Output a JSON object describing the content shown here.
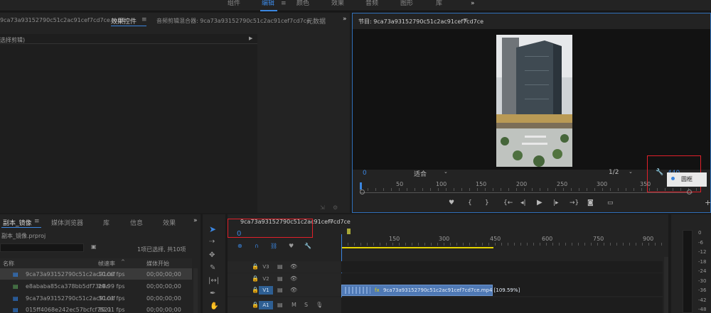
{
  "workspaces": [
    "组件",
    "编辑",
    "颜色",
    "效果",
    "音频",
    "图形",
    "库"
  ],
  "workspace_active_index": 1,
  "workspace_more": "»",
  "source_panel": {
    "tab_clip": "9ca73a93152790c51c2ac91cef7cd7ce.mp4",
    "tab_effects": "效果控件",
    "tab_mixer": "音频剪辑混合器: 9ca73a93152790c51c2ac91cef7cd7ce",
    "tab_meta": "元数据",
    "more": "»",
    "selection_hint": "选择剪辑)"
  },
  "program_monitor": {
    "title": "节目: 9ca73a93152790c51c2ac91cef7cd7ce",
    "timecode_left": "0",
    "fit_label": "适合",
    "quality": "1/2",
    "timecode_right": "440",
    "popup_item": "圆框",
    "ruler_labels": [
      "50",
      "100",
      "150",
      "200",
      "250",
      "300",
      "350"
    ],
    "controls": [
      "♥",
      "{",
      "}",
      "{←",
      "◂|",
      "▶",
      "|▸",
      "→}",
      "◙",
      "▭",
      "+"
    ]
  },
  "project_panel": {
    "tab_project": "副本_镜像",
    "tab_media": "媒体浏览器",
    "tab_library": "库",
    "tab_info": "信息",
    "tab_effects": "效果",
    "more": "»",
    "file_name": "副本_镜像.prproj",
    "selection_status": "1项已选择, 共10项",
    "col_name": "名称",
    "col_fps": "帧速率",
    "col_start": "媒体开始",
    "rows": [
      {
        "name": "9ca73a93152790c51c2ac91cef",
        "fps": "10.00 fps",
        "start": "00;00;00;00"
      },
      {
        "name": "e8ababa85ca378bb5df73b8c",
        "fps": "29.99 fps",
        "start": "00;00;00;00"
      },
      {
        "name": "9ca73a93152790c51c2ac91cef",
        "fps": "30.01 fps",
        "start": "00;00;00;00"
      },
      {
        "name": "015ff4068e242ec57bcfcf7521",
        "fps": "30.01 fps",
        "start": "00;00;00;00"
      }
    ]
  },
  "timeline": {
    "title": "9ca73a93152790c51c2ac91cef7cd7ce",
    "timecode": "0",
    "ruler_labels": [
      "150",
      "300",
      "450",
      "600",
      "750",
      "900"
    ],
    "tracks": [
      "V3",
      "V2",
      "V1",
      "A1"
    ],
    "clip_label": "9ca73a93152790c51c2ac91cef7cd7ce.mp4 [109.59%]",
    "clip_fx": "fx"
  },
  "meters": {
    "labels": [
      "0",
      "-6",
      "-12",
      "-18",
      "-24",
      "-30",
      "-36",
      "-42",
      "-48"
    ]
  },
  "colors": {
    "accent": "#3b86e0",
    "highlight_box": "#e0202a",
    "clip": "#4f79b5",
    "work_area": "#e6d400"
  }
}
